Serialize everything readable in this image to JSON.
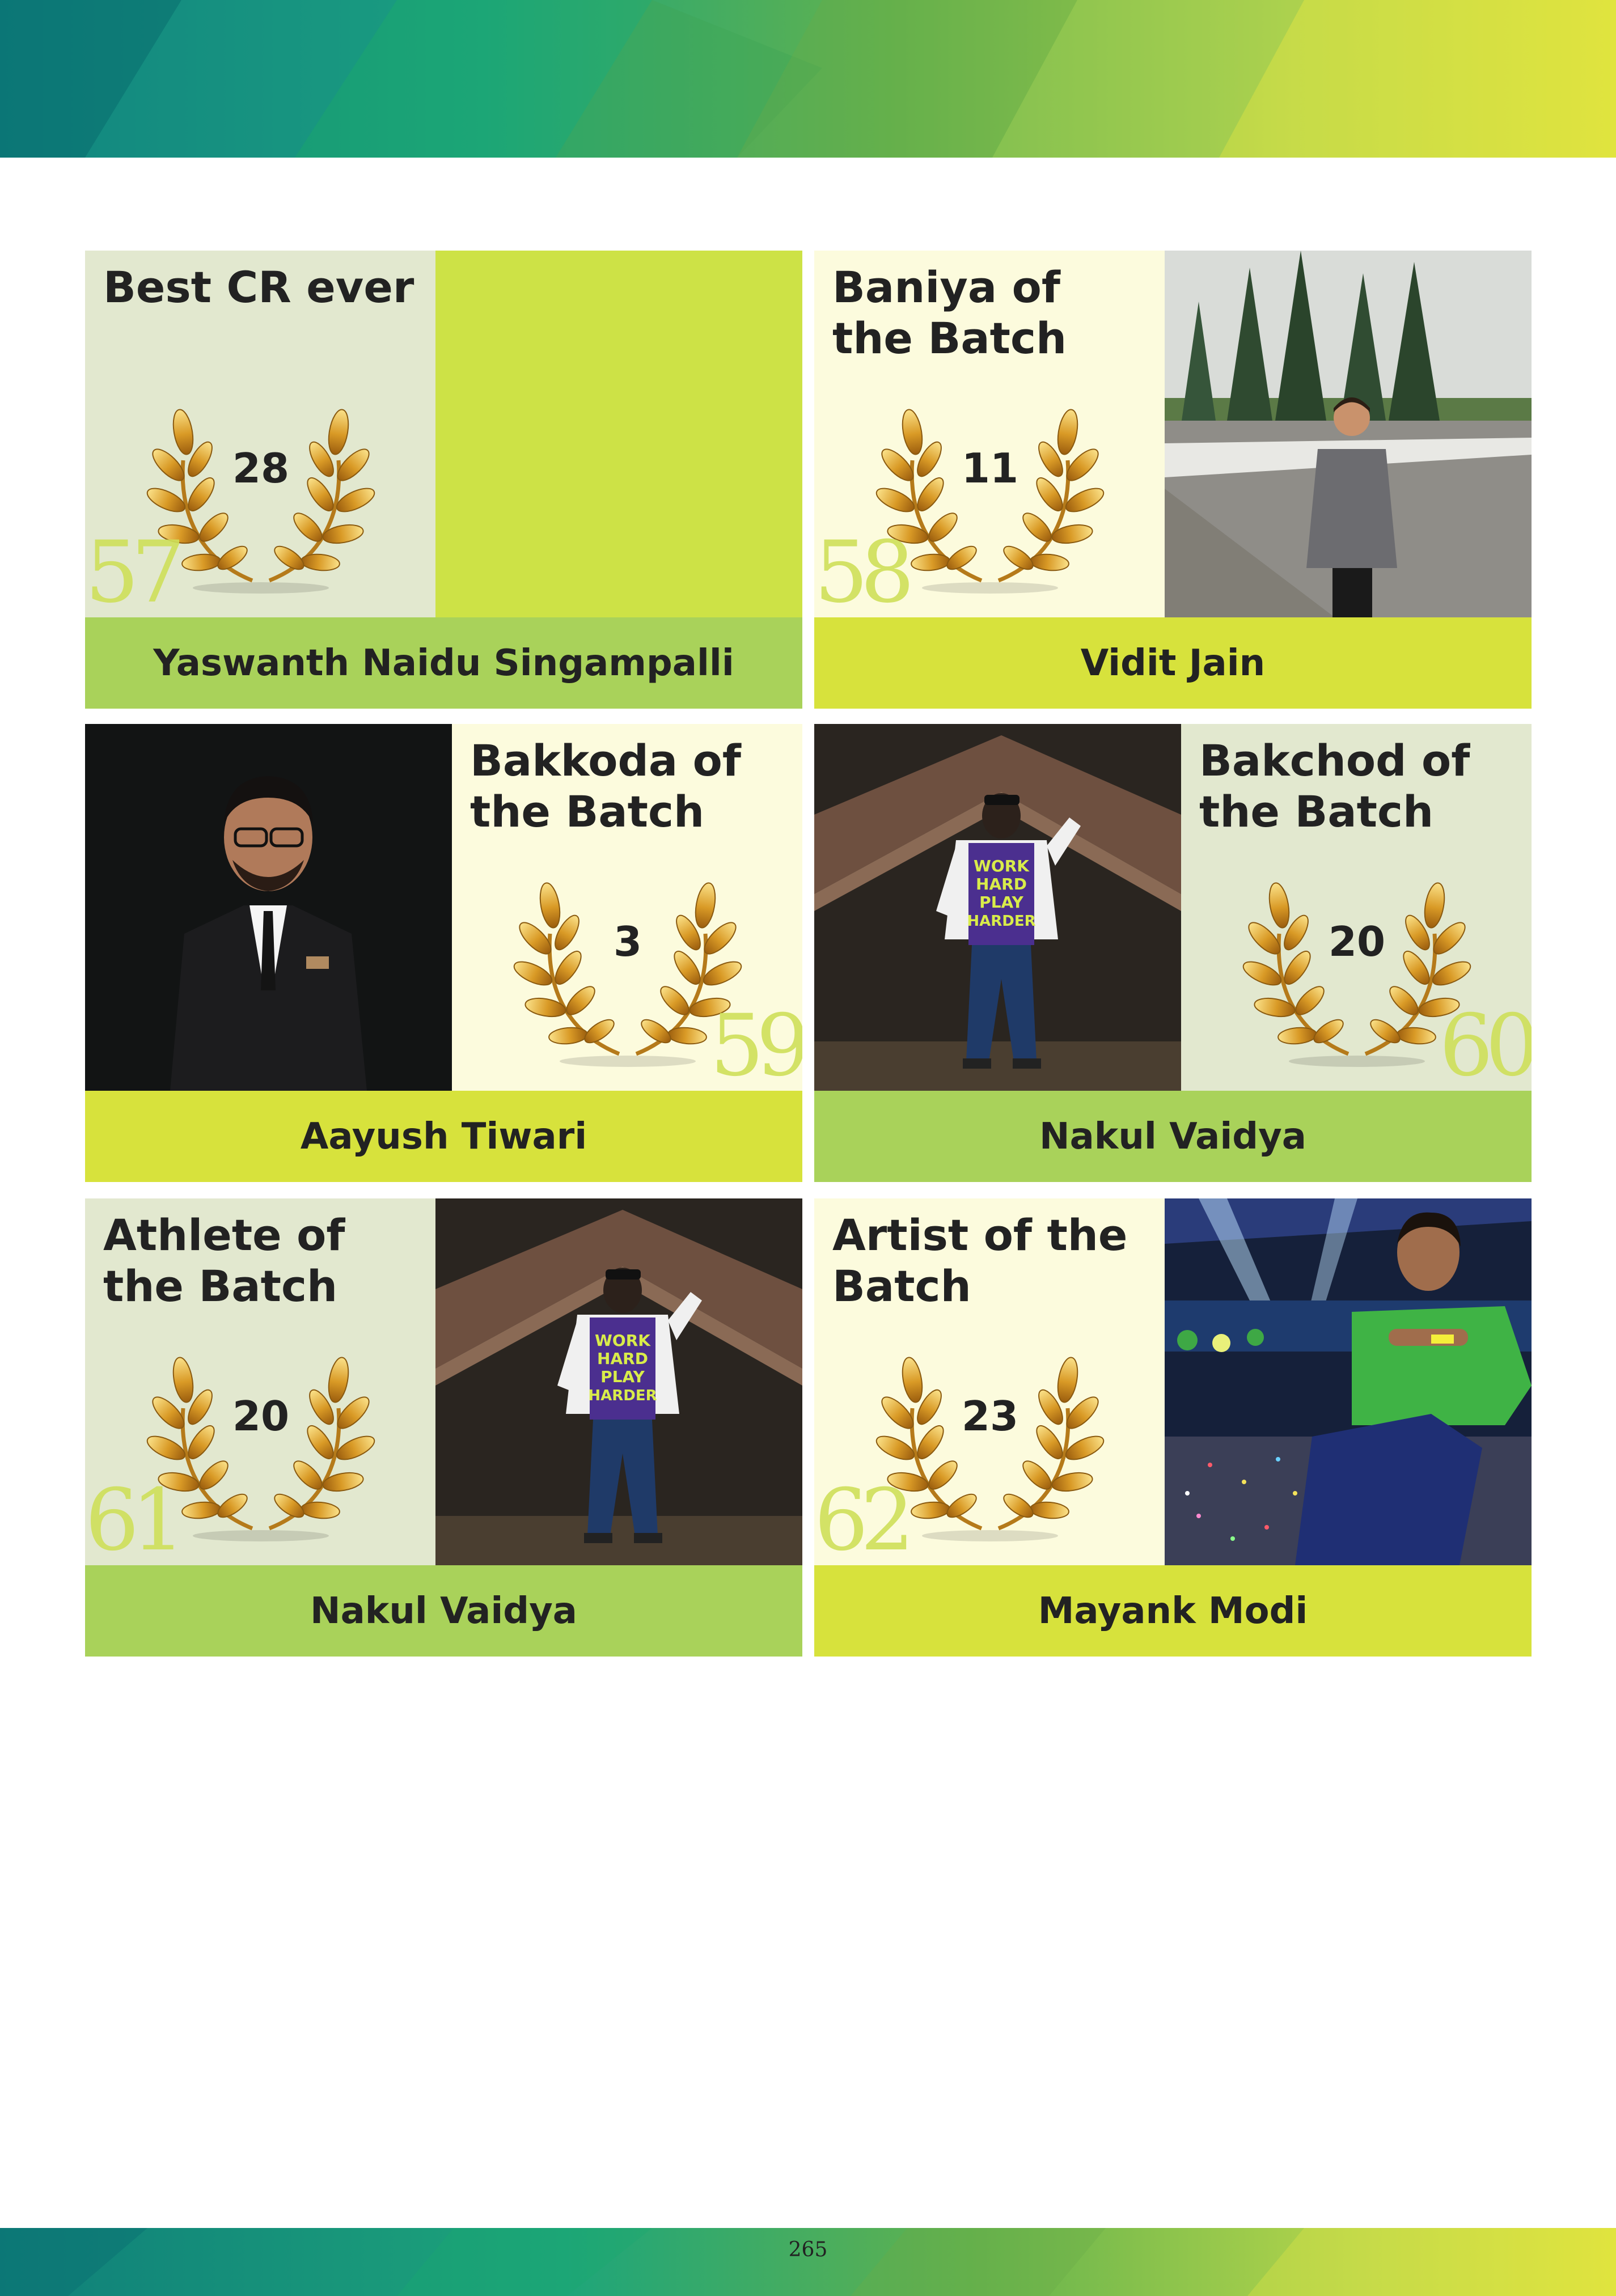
{
  "page": {
    "number": "265"
  },
  "colors": {
    "card_sage": "#e2e8cf",
    "card_cream": "#fcfbdd",
    "name_band_green": "#a9d25a",
    "name_band_yellow": "#d7e23c",
    "placeholder_lime": "#cde246",
    "award_number": "#cfe05a"
  },
  "awards": [
    {
      "number": "57",
      "title": "Best CR ever",
      "votes": "28",
      "name": "Yaswanth Naidu Singampalli",
      "photo": "placeholder-blank"
    },
    {
      "number": "58",
      "title": "Baniya of the Batch",
      "votes": "11",
      "name": "Vidit Jain",
      "photo": "man-in-grey-tshirt-by-road"
    },
    {
      "number": "59",
      "title": "Bakkoda of the Batch",
      "votes": "3",
      "name": "Aayush Tiwari",
      "photo": "man-in-black-suit-portrait"
    },
    {
      "number": "60",
      "title": "Bakchod of the Batch",
      "votes": "20",
      "name": "Nakul Vaidya",
      "photo": "man-standing-on-rooftop"
    },
    {
      "number": "61",
      "title": "Athlete of the Batch",
      "votes": "20",
      "name": "Nakul Vaidya",
      "photo": "man-standing-on-rooftop"
    },
    {
      "number": "62",
      "title": "Artist of the Batch",
      "votes": "23",
      "name": "Mayank Modi",
      "photo": "man-seated-at-concert"
    }
  ]
}
